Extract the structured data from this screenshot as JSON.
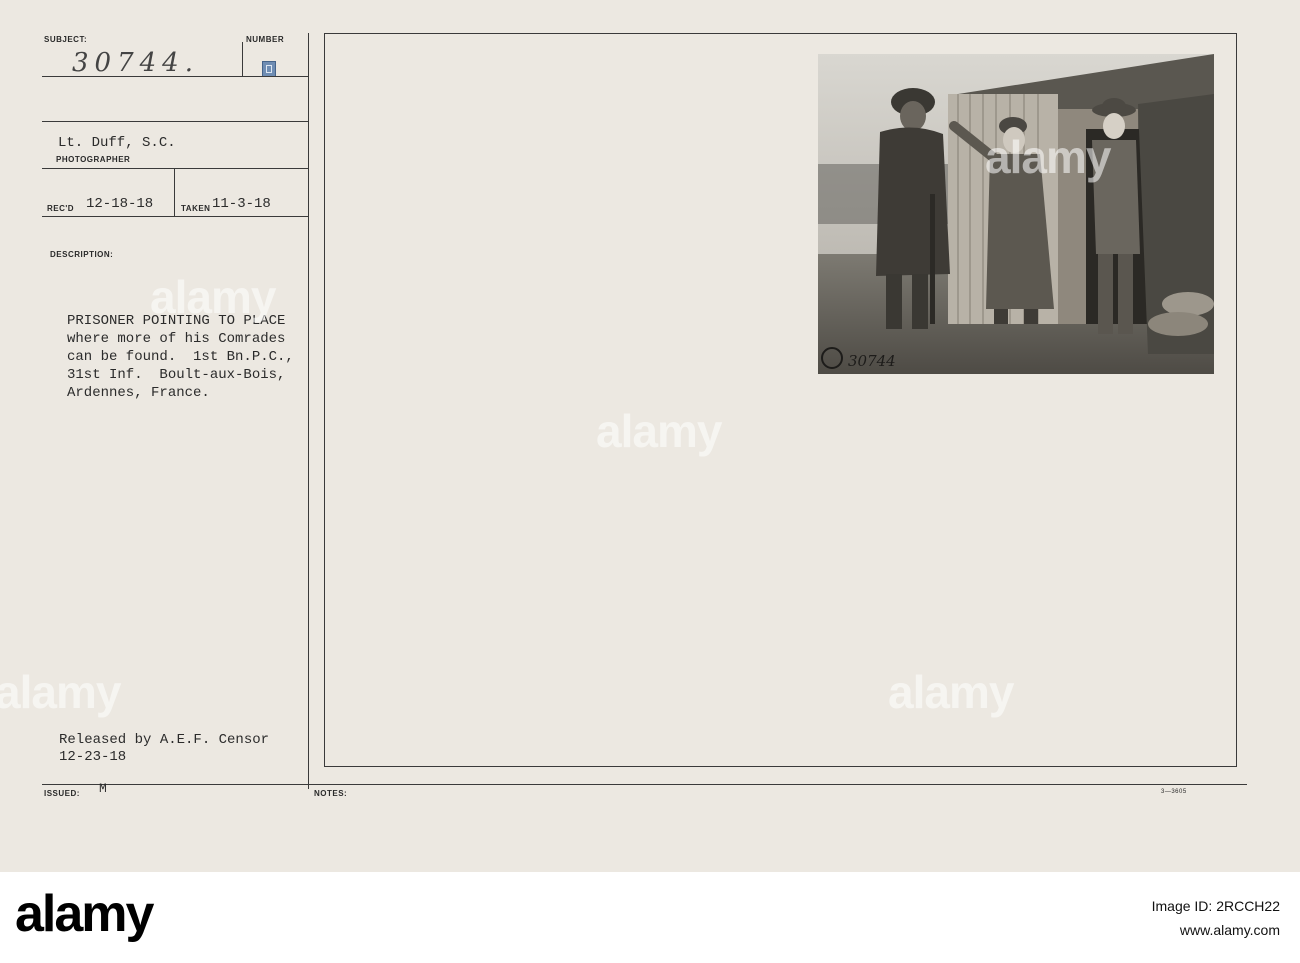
{
  "card": {
    "subject_label": "SUBJECT:",
    "subject_value": "30744.",
    "number_label": "NUMBER",
    "photographer_name": "Lt. Duff, S.C.",
    "photographer_label": "PHOTOGRAPHER",
    "recd_label": "REC'D",
    "recd_value": "12-18-18",
    "taken_label": "TAKEN",
    "taken_value": "11-3-18",
    "description_label": "DESCRIPTION:",
    "description_lines": [
      "PRISONER POINTING TO PLACE",
      "where more of his Comrades",
      "can be found.  1st Bn.P.C.,",
      "31st Inf.  Boult-aux-Bois,",
      "Ardennes, France."
    ],
    "released_line1": "Released by A.E.F. Censor",
    "released_line2": "12-23-18",
    "issued_label": "ISSUED:",
    "issued_value": "M",
    "notes_label": "NOTES:",
    "form_code": "3—3605",
    "photo_caption_number": "30744"
  },
  "watermark_text": "alamy",
  "footer": {
    "logo_text": "alamy",
    "image_id_line": "Image ID: 2RCCH22",
    "url_line": "www.alamy.com"
  }
}
